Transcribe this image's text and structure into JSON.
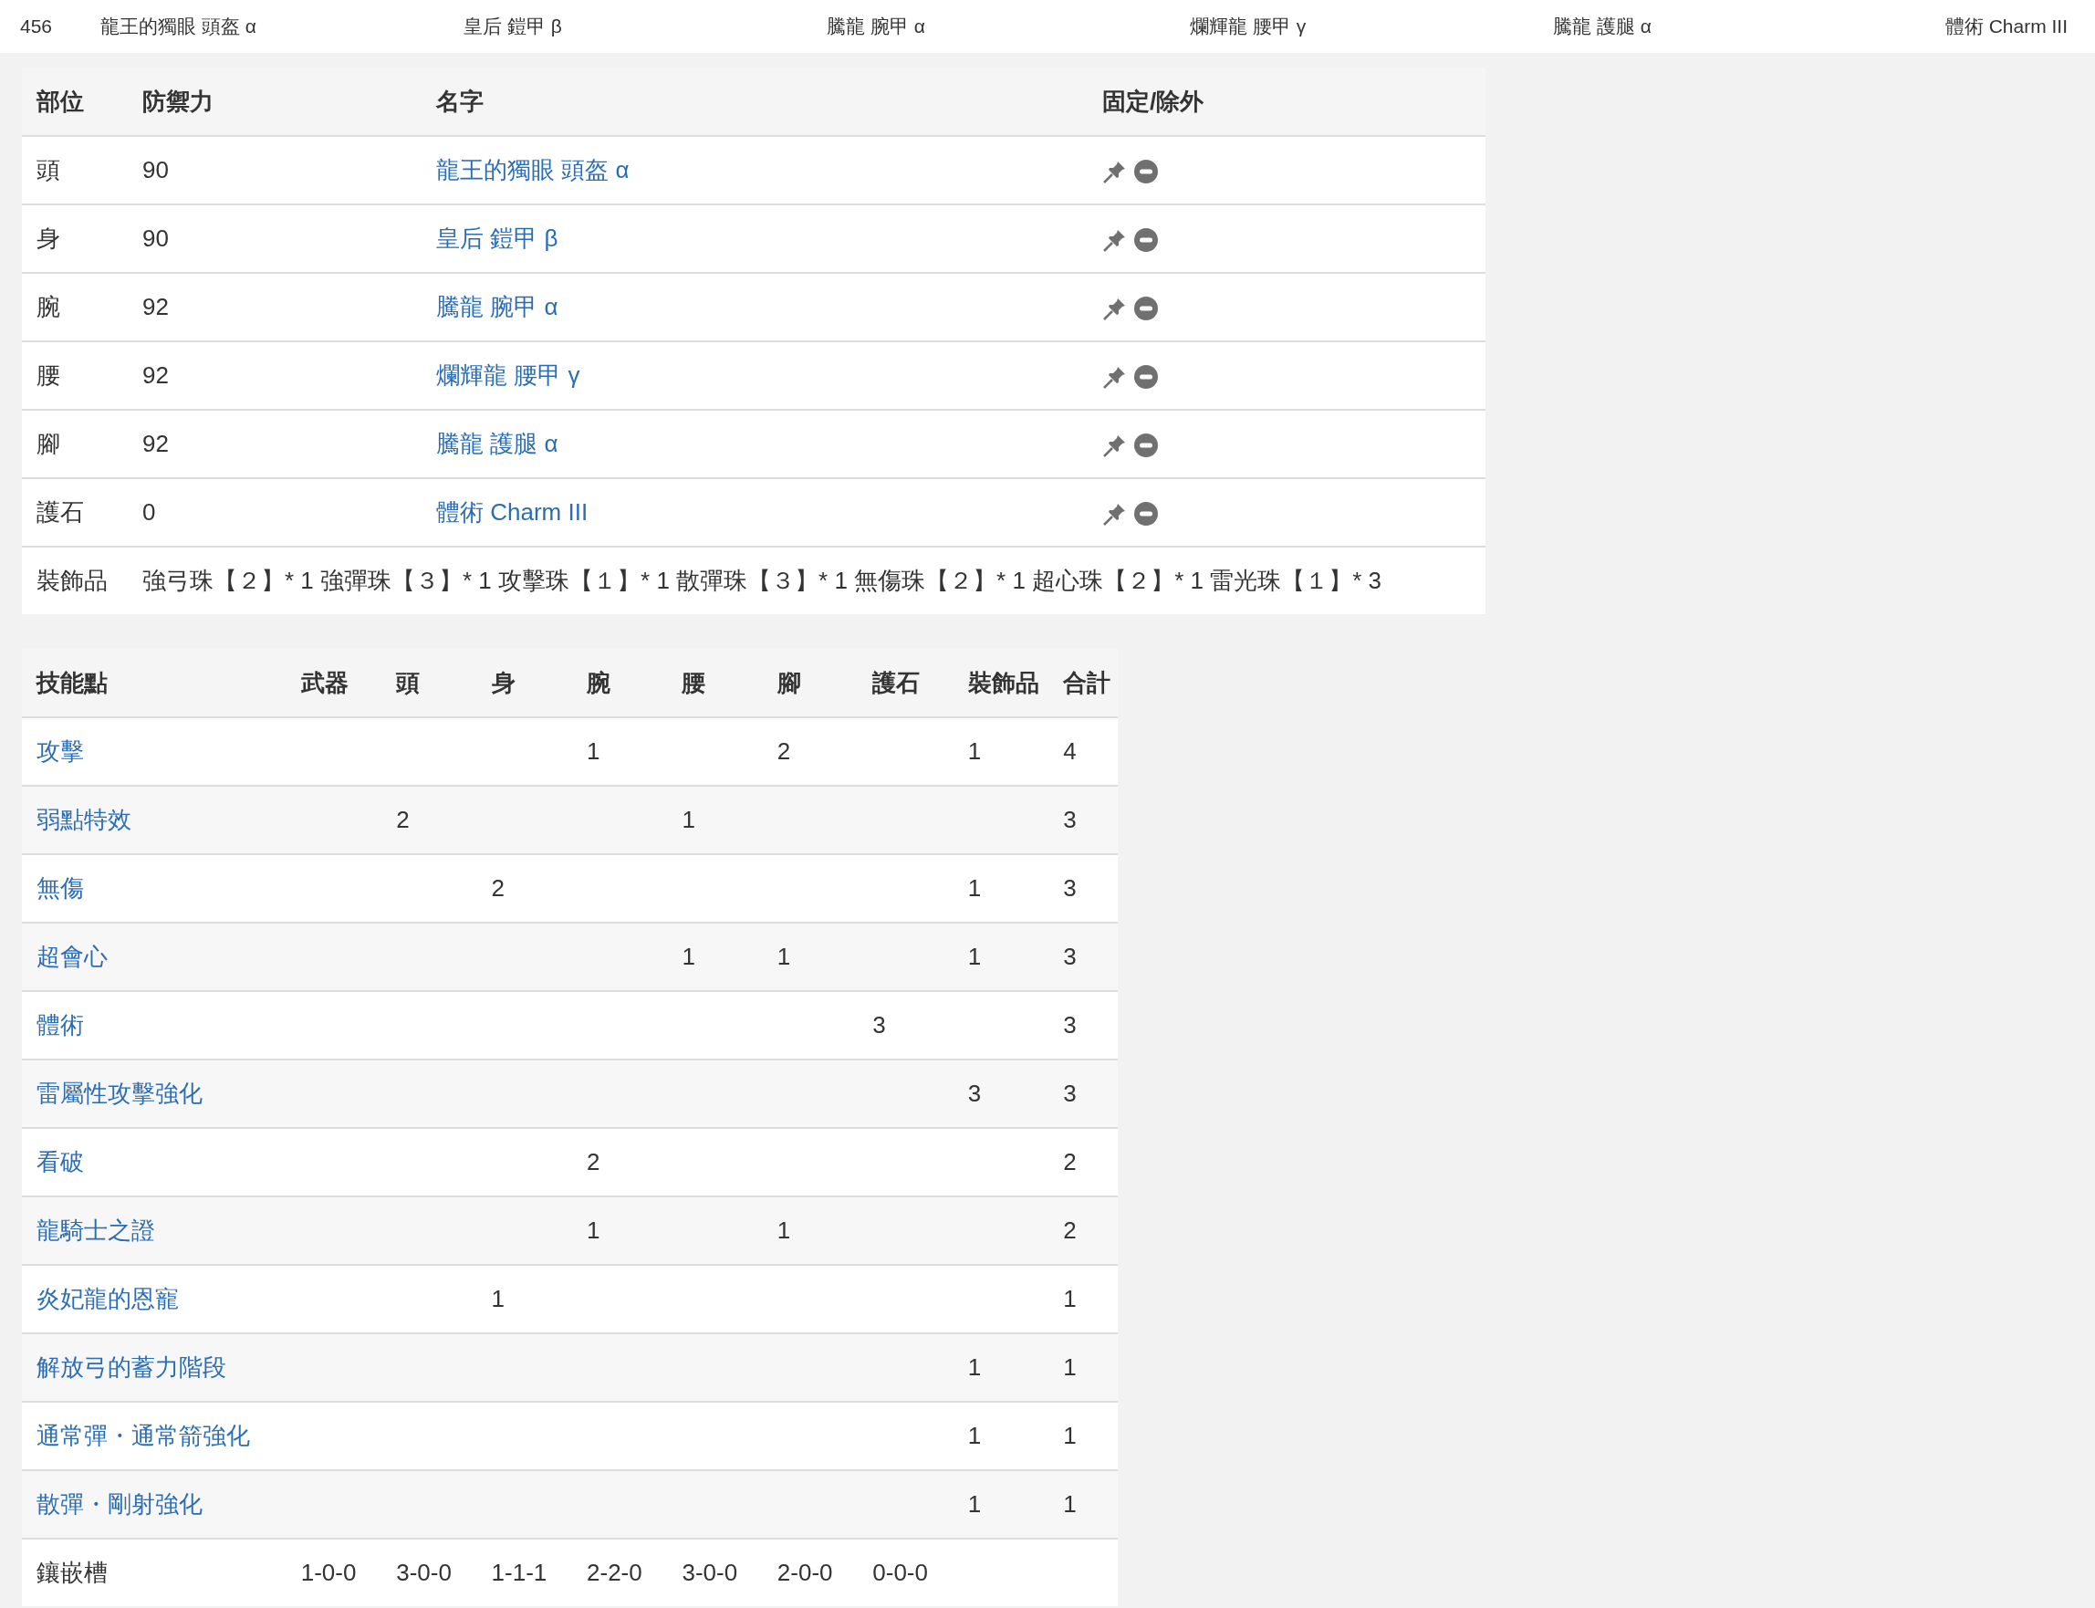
{
  "top_bar": {
    "count": "456",
    "items": [
      "龍王的獨眼 頭盔 α",
      "皇后 鎧甲 β",
      "騰龍 腕甲 α",
      "爛輝龍 腰甲 γ",
      "騰龍 護腿 α",
      "體術 Charm III"
    ]
  },
  "equipment_table": {
    "columns": [
      "部位",
      "防禦力",
      "名字",
      "固定/除外"
    ],
    "rows": [
      {
        "part": "頭",
        "defense": "90",
        "name": "龍王的獨眼 頭盔 α"
      },
      {
        "part": "身",
        "defense": "90",
        "name": "皇后 鎧甲 β"
      },
      {
        "part": "腕",
        "defense": "92",
        "name": "騰龍 腕甲 α"
      },
      {
        "part": "腰",
        "defense": "92",
        "name": "爛輝龍 腰甲 γ"
      },
      {
        "part": "腳",
        "defense": "92",
        "name": "騰龍 護腿 α"
      },
      {
        "part": "護石",
        "defense": "0",
        "name": "體術 Charm III"
      }
    ],
    "decorations": {
      "label": "裝飾品",
      "value": "強弓珠【２】* 1 強彈珠【３】* 1 攻擊珠【１】* 1 散彈珠【３】* 1 無傷珠【２】* 1 超心珠【２】* 1 雷光珠【１】* 3"
    }
  },
  "skills_table": {
    "columns": [
      "技能點",
      "武器",
      "頭",
      "身",
      "腕",
      "腰",
      "腳",
      "護石",
      "裝飾品",
      "合計"
    ],
    "rows": [
      {
        "skill": "攻擊",
        "arms": "1",
        "legs": "2",
        "decorations": "1",
        "total": "4"
      },
      {
        "skill": "弱點特效",
        "head": "2",
        "waist": "1",
        "total": "3"
      },
      {
        "skill": "無傷",
        "body": "2",
        "decorations": "1",
        "total": "3"
      },
      {
        "skill": "超會心",
        "waist": "1",
        "legs": "1",
        "decorations": "1",
        "total": "3"
      },
      {
        "skill": "體術",
        "charm": "3",
        "total": "3"
      },
      {
        "skill": "雷屬性攻擊強化",
        "decorations": "3",
        "total": "3"
      },
      {
        "skill": "看破",
        "arms": "2",
        "total": "2"
      },
      {
        "skill": "龍騎士之證",
        "arms": "1",
        "legs": "1",
        "total": "2"
      },
      {
        "skill": "炎妃龍的恩寵",
        "body": "1",
        "total": "1"
      },
      {
        "skill": "解放弓的蓄力階段",
        "decorations": "1",
        "total": "1"
      },
      {
        "skill": "通常彈・通常箭強化",
        "decorations": "1",
        "total": "1"
      },
      {
        "skill": "散彈・剛射強化",
        "decorations": "1",
        "total": "1"
      }
    ],
    "slots": {
      "label": "鑲嵌槽",
      "weapon": "1-0-0",
      "head": "3-0-0",
      "body": "1-1-1",
      "arms": "2-2-0",
      "waist": "3-0-0",
      "legs": "2-0-0",
      "charm": "0-0-0"
    }
  }
}
